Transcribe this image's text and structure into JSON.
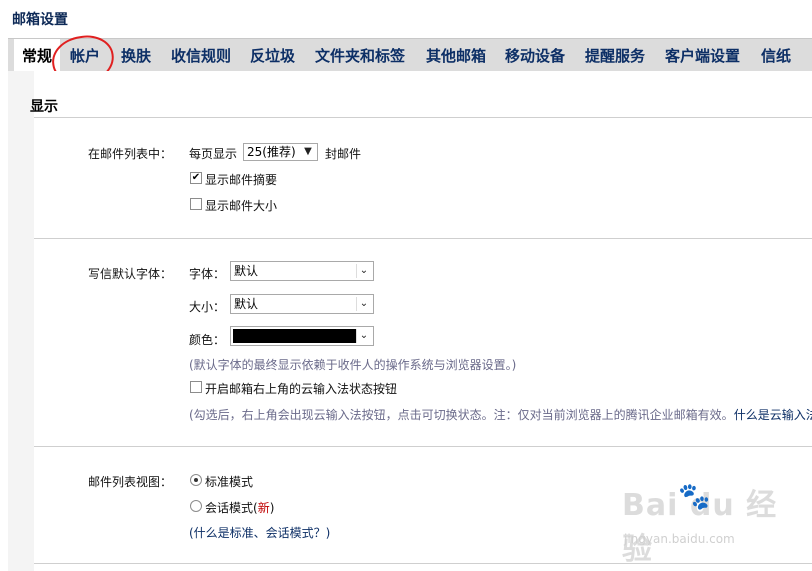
{
  "page_title": "邮箱设置",
  "tabs": [
    {
      "label": "常规"
    },
    {
      "label": "帐户"
    },
    {
      "label": "换肤"
    },
    {
      "label": "收信规则"
    },
    {
      "label": "反垃圾"
    },
    {
      "label": "文件夹和标签"
    },
    {
      "label": "其他邮箱"
    },
    {
      "label": "移动设备"
    },
    {
      "label": "提醒服务"
    },
    {
      "label": "客户端设置"
    },
    {
      "label": "信纸"
    }
  ],
  "active_tab": "常规",
  "display": {
    "section_title": "显示",
    "mail_list": {
      "label": "在邮件列表中：",
      "per_page_prefix": "每页显示",
      "per_page_value": "25(推荐)",
      "per_page_suffix": "封邮件",
      "show_summary": {
        "label": "显示邮件摘要",
        "checked": true
      },
      "show_size": {
        "label": "显示邮件大小",
        "checked": false
      }
    },
    "default_font": {
      "label": "写信默认字体：",
      "font_label": "字体：",
      "font_value": "默认",
      "size_label": "大小：",
      "size_value": "默认",
      "color_label": "颜色：",
      "color_value": "#000000",
      "note": "(默认字体的最终显示依赖于收件人的操作系统与浏览器设置。)",
      "ime_toggle": {
        "label": "开启邮箱右上角的云输入法状态按钮",
        "checked": false
      },
      "ime_note": "(勾选后，右上角会出现云输入法按钮，点击可切换状态。注：仅对当前浏览器上的腾讯企业邮箱有效。",
      "ime_link": "什么是云输入法"
    },
    "list_view": {
      "label": "邮件列表视图：",
      "standard": {
        "label": "标准模式",
        "selected": true
      },
      "conversation": {
        "label": "会话模式",
        "badge": "新",
        "selected": false
      },
      "help_link": "(什么是标准、会话模式？)"
    }
  },
  "watermark": {
    "brand": "Bai du 经验",
    "url": "jingyan.baidu.com"
  }
}
